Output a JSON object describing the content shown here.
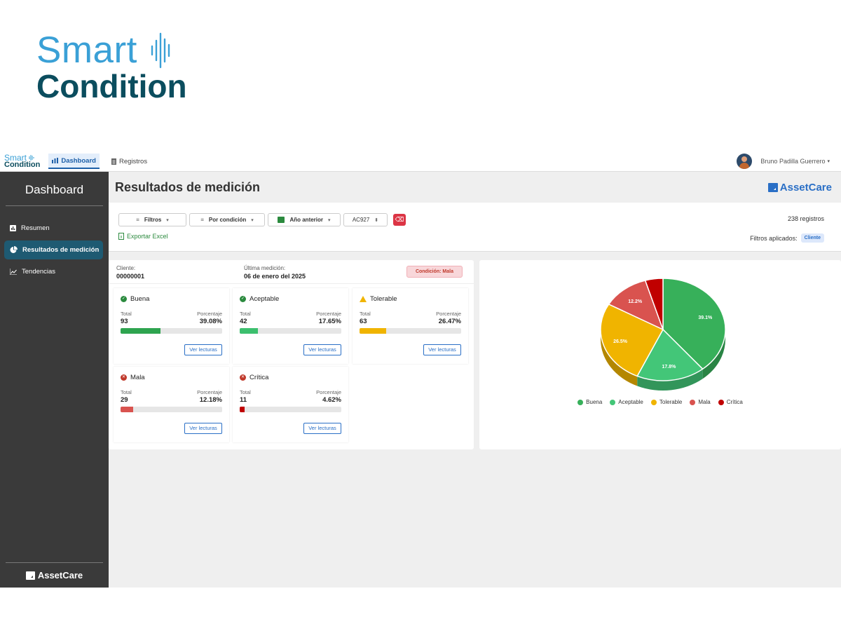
{
  "hero": {
    "line1": "Smart",
    "line2": "Condition"
  },
  "topbar": {
    "logo_line1": "Smart",
    "logo_line2": "Condition",
    "tabs": [
      {
        "label": "Dashboard"
      },
      {
        "label": "Registros"
      }
    ],
    "user_name": "Bruno Padilla Guerrero"
  },
  "sidebar": {
    "title": "Dashboard",
    "items": [
      {
        "label": "Resumen"
      },
      {
        "label": "Resultados de medición"
      },
      {
        "label": "Tendencias"
      }
    ],
    "footer": "AssetCare"
  },
  "main": {
    "title": "Resultados de medición",
    "brand": "AssetCare",
    "filters": {
      "filtros": "Filtros",
      "por_condicion": "Por condición",
      "periodo": "Año anterior",
      "equipo": "AC927",
      "export": "Exportar Excel",
      "records": "238 registros",
      "applied_label": "Filtros aplicados:",
      "applied_chip": "Cliente"
    },
    "summary": {
      "cliente_label": "Cliente:",
      "cliente_value": "00000001",
      "medicion_label": "Última medición:",
      "medicion_value": "06 de enero del 2025",
      "condicion_badge": "Condición: Mala"
    },
    "cards": [
      {
        "name": "Buena",
        "total_label": "Total",
        "pct_label": "Porcentaje",
        "total": "93",
        "pct": "39.08%",
        "fraction": 0.3908,
        "color": "#2ea44f",
        "button": "Ver lecturas"
      },
      {
        "name": "Aceptable",
        "total_label": "Total",
        "pct_label": "Porcentaje",
        "total": "42",
        "pct": "17.65%",
        "fraction": 0.1765,
        "color": "#3cbf6e",
        "button": "Ver lecturas"
      },
      {
        "name": "Tolerable",
        "total_label": "Total",
        "pct_label": "Porcentaje",
        "total": "63",
        "pct": "26.47%",
        "fraction": 0.2647,
        "color": "#f0b400",
        "button": "Ver lecturas"
      },
      {
        "name": "Mala",
        "total_label": "Total",
        "pct_label": "Porcentaje",
        "total": "29",
        "pct": "12.18%",
        "fraction": 0.1218,
        "color": "#d9534f",
        "button": "Ver lecturas"
      },
      {
        "name": "Crítica",
        "total_label": "Total",
        "pct_label": "Porcentaje",
        "total": "11",
        "pct": "4.62%",
        "fraction": 0.0462,
        "color": "#c00000",
        "button": "Ver lecturas"
      }
    ]
  },
  "chart_data": {
    "type": "pie",
    "categories": [
      "Buena",
      "Aceptable",
      "Tolerable",
      "Mala",
      "Crítica"
    ],
    "values": [
      39.1,
      17.8,
      26.5,
      12.2,
      4.6
    ],
    "labels": [
      "39.1%",
      "17.8%",
      "26.5%",
      "12.2%",
      ""
    ],
    "colors": [
      "#37b05a",
      "#43c678",
      "#f0b400",
      "#d9534f",
      "#c00000"
    ],
    "legend_position": "bottom"
  }
}
